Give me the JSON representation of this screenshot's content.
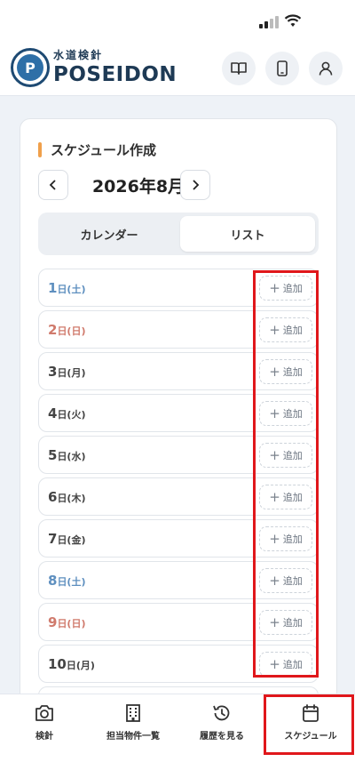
{
  "header": {
    "logo_mark": "P",
    "logo_sub": "水道検針",
    "logo_main": "POSEIDON"
  },
  "icons": {
    "manual": "book-icon",
    "device": "phone-icon",
    "profile": "user-icon"
  },
  "schedule": {
    "title": "スケジュール作成",
    "month_label": "2026年8月",
    "prev_label": "‹",
    "next_label": "›",
    "tabs": [
      {
        "label": "カレンダー",
        "active": false
      },
      {
        "label": "リスト",
        "active": true
      }
    ],
    "add_label": "追加",
    "days": [
      {
        "num": "1",
        "wd": "日(土)",
        "type": "sat"
      },
      {
        "num": "2",
        "wd": "日(日)",
        "type": "sun"
      },
      {
        "num": "3",
        "wd": "日(月)",
        "type": "wk"
      },
      {
        "num": "4",
        "wd": "日(火)",
        "type": "wk"
      },
      {
        "num": "5",
        "wd": "日(水)",
        "type": "wk"
      },
      {
        "num": "6",
        "wd": "日(木)",
        "type": "wk"
      },
      {
        "num": "7",
        "wd": "日(金)",
        "type": "wk"
      },
      {
        "num": "8",
        "wd": "日(土)",
        "type": "sat"
      },
      {
        "num": "9",
        "wd": "日(日)",
        "type": "sun"
      },
      {
        "num": "10",
        "wd": "日(月)",
        "type": "wk"
      },
      {
        "num": "",
        "wd": "",
        "type": "wk"
      }
    ]
  },
  "bottom_nav": [
    {
      "label": "検針",
      "icon": "camera-icon"
    },
    {
      "label": "担当物件一覧",
      "icon": "building-icon"
    },
    {
      "label": "履歴を見る",
      "icon": "history-icon"
    },
    {
      "label": "スケジュール",
      "icon": "calendar-icon"
    }
  ],
  "colors": {
    "accent": "#f0a04b",
    "brand": "#1e3a55",
    "saturday": "#5e8fbf",
    "sunday": "#d07a6c",
    "highlight": "#e0171b"
  }
}
